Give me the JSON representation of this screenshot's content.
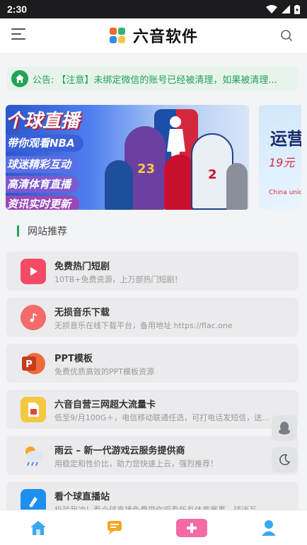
{
  "status_bar": {
    "time": "2:30"
  },
  "header": {
    "title": "六音软件"
  },
  "notice": {
    "label": "公告:",
    "text": "【注意】未绑定微信的账号已经被清理，如果被清理..."
  },
  "banner": {
    "title": "个球直播",
    "tags": [
      "带你观看NBA",
      "球迷精彩互动",
      "高清体育直播",
      "资讯实时更新"
    ],
    "jersey_left": "23",
    "jersey_right": "2"
  },
  "banner2": {
    "title": "运营",
    "price": "19元",
    "brand": "China unicom中国联通"
  },
  "section": {
    "title": "网站推荐"
  },
  "items": [
    {
      "title": "免费热门短剧",
      "desc": "10TB+免费资源，上万部热门短剧！",
      "icon": "play-icon",
      "color": "#f34b66"
    },
    {
      "title": "无损音乐下载",
      "desc": "无损音乐在线下载平台，备用地址 https://flac.one",
      "icon": "music-note-icon",
      "color": "#f46b6b"
    },
    {
      "title": "PPT模板",
      "desc": "免费优质高效的PPT模板资源",
      "icon": "powerpoint-icon",
      "color": "#d35230"
    },
    {
      "title": "六音自营三网超大流量卡",
      "desc": "低至9/月100G＋，电信移动联通任选，可打电话发短信，送...",
      "icon": "sim-card-icon",
      "color": "#f5c842"
    },
    {
      "title": "雨云 – 新一代游戏云服务提供商",
      "desc": "用稳定和性价比，助力您快速上云，强烈推荐！",
      "icon": "cloud-rain-icon",
      "color": "#ffffff"
    },
    {
      "title": "看个球直播站",
      "desc": "极验我冲！看个球直播免费带你观看所有体育赛事，球迷互...",
      "icon": "basketball-app-icon",
      "color": "#1d8ff0"
    }
  ]
}
